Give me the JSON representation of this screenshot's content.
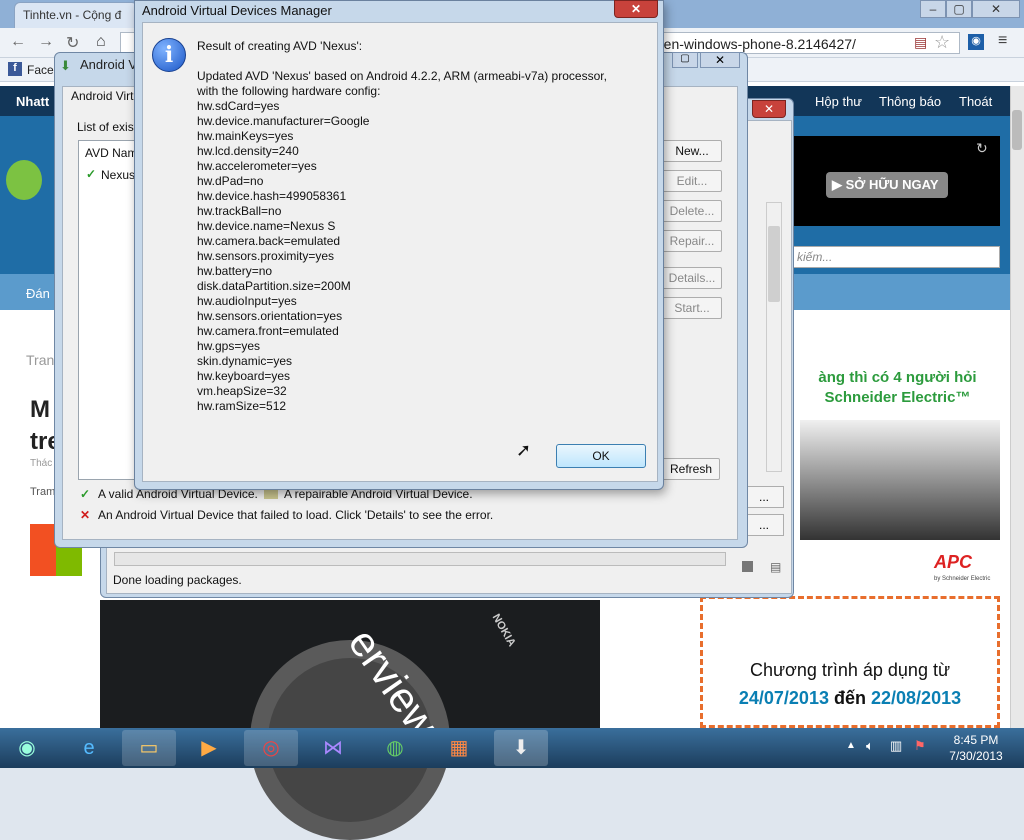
{
  "browser": {
    "tab_active": "Tinhte.vn - Cộng đ",
    "url": "ren-windows-phone-8.2146427/",
    "bookmark_facebook": "Face",
    "nav_right": [
      "Hộp thư",
      "Thông báo",
      "Thoát"
    ],
    "nav_left": "Nhatt",
    "nav2_left": "Đán",
    "ad_button": "SỞ HỮU NGAY",
    "search_placeholder": "kiếm...",
    "promo_text": "àng thì có 4 người hỏi Schneider Electric™",
    "promo_brand": "APC",
    "promo_brand_sub": "by Schneider Electric",
    "bottom_ad_line1": "Chương trình áp dụng từ",
    "bottom_ad_date1": "24/07/2013",
    "bottom_ad_mid": "đến",
    "bottom_ad_date2": "22/08/2013",
    "phone_word": "erview d",
    "phone_brand": "NOKIA",
    "left_texts": [
      "Tran",
      "M",
      "tre",
      "Thác",
      "Tram"
    ]
  },
  "avd_manager": {
    "title": "Android Virt",
    "inner_label": "Android Virt",
    "list_label": "List of exist",
    "table_header": "AVD Nam",
    "table_row": "Nexus",
    "buttons": {
      "new": "New...",
      "edit": "Edit...",
      "delete": "Delete...",
      "repair": "Repair...",
      "details": "Details...",
      "start": "Start...",
      "refresh": "Refresh"
    },
    "legend": {
      "valid": "A valid Android Virtual Device.",
      "repairable": "A repairable Android Virtual Device.",
      "failed": "An Android Virtual Device that failed to load. Click 'Details' to see the error."
    }
  },
  "sdk_manager": {
    "status": "Done loading packages."
  },
  "dialog": {
    "window_title": "Android Virtual Devices Manager",
    "heading": "Result of creating AVD 'Nexus':",
    "summary_line1": "Updated AVD 'Nexus' based on Android 4.2.2, ARM (armeabi-v7a) processor,",
    "summary_line2": "with the following hardware config:",
    "config": [
      "hw.sdCard=yes",
      "hw.device.manufacturer=Google",
      "hw.mainKeys=yes",
      "hw.lcd.density=240",
      "hw.accelerometer=yes",
      "hw.dPad=no",
      "hw.device.hash=499058361",
      "hw.trackBall=no",
      "hw.device.name=Nexus S",
      "hw.camera.back=emulated",
      "hw.sensors.proximity=yes",
      "hw.battery=no",
      "disk.dataPartition.size=200M",
      "hw.audioInput=yes",
      "hw.sensors.orientation=yes",
      "hw.camera.front=emulated",
      "hw.gps=yes",
      "skin.dynamic=yes",
      "hw.keyboard=yes",
      "vm.heapSize=32",
      "hw.ramSize=512"
    ],
    "ok_label": "OK",
    "close_glyph": "✕"
  },
  "taskbar": {
    "time": "8:45 PM",
    "date": "7/30/2013",
    "items": [
      "start-orb-icon",
      "internet-explorer-icon",
      "file-explorer-icon",
      "media-player-icon",
      "chrome-icon",
      "visual-studio-icon",
      "network-globe-icon",
      "apps-grid-icon",
      "download-manager-icon"
    ]
  }
}
